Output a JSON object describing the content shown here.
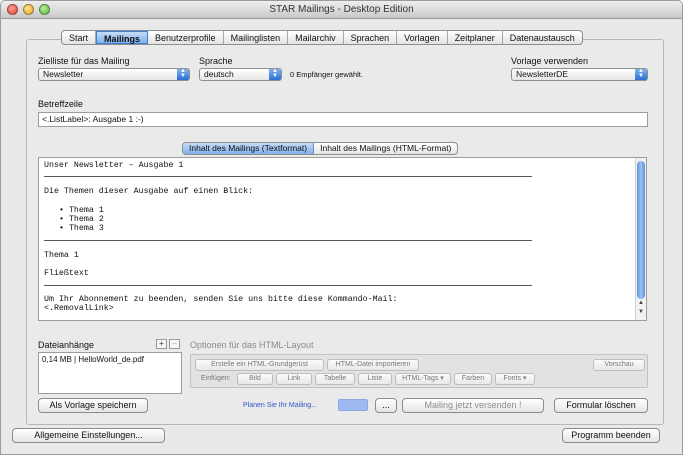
{
  "window": {
    "title": "STAR Mailings - Desktop Edition"
  },
  "tabs": [
    {
      "label": "Start"
    },
    {
      "label": "Mailings",
      "active": true
    },
    {
      "label": "Benutzerprofile"
    },
    {
      "label": "Mailinglisten"
    },
    {
      "label": "Mailarchiv"
    },
    {
      "label": "Sprachen"
    },
    {
      "label": "Vorlagen"
    },
    {
      "label": "Zeitplaner"
    },
    {
      "label": "Datenaustausch"
    }
  ],
  "form": {
    "zielliste_label": "Zielliste für das Mailing",
    "zielliste_value": "Newsletter",
    "sprache_label": "Sprache",
    "sprache_value": "deutsch",
    "empfaenger_text": "0 Empfänger gewählt.",
    "vorlage_label": "Vorlage verwenden",
    "vorlage_value": "NewsletterDE",
    "betreff_label": "Betreffzeile",
    "betreff_value": "<.ListLabel>: Ausgabe 1 :-)"
  },
  "content_tabs": [
    {
      "label": "Inhalt des Mailings (Textformat)",
      "active": true
    },
    {
      "label": "Inhalt des Mailings (HTML-Format)"
    }
  ],
  "mail_body": {
    "line1": "Unser Newsletter – Ausgabe 1",
    "line2": "Die Themen dieser Ausgabe auf einen Blick:",
    "bullets": [
      "• Thema 1",
      "• Thema 2",
      "• Thema 3"
    ],
    "line3": "Thema 1",
    "line4": "Fließtext",
    "line5": "Um Ihr Abonnement zu beenden, senden Sie uns bitte diese Kommando-Mail:",
    "line6": "<.RemovalLink>"
  },
  "attachments": {
    "label": "Dateianhänge",
    "add": "+",
    "remove": "−",
    "items": [
      "0,14 MB | HelloWorld_de.pdf"
    ]
  },
  "html_options": {
    "label": "Optionen für das HTML-Layout",
    "btn_grundgeruest": "Erstelle ein HTML-Grundgerüst",
    "btn_import": "HTML-Datei importieren",
    "btn_preview": "Vorschau",
    "einfuegen_label": "Einfügen:",
    "insert_buttons": [
      "Bild",
      "Link",
      "Tabelle",
      "Liste",
      "HTML-Tags ▾",
      "Farben",
      "Fonts ▾"
    ]
  },
  "actions": {
    "save_template": "Als Vorlage speichern",
    "plan_link": "Planen Sie Ihr Mailing...",
    "more": "...",
    "send": "Mailing jetzt versenden !",
    "clear": "Formular löschen"
  },
  "footer": {
    "settings": "Allgemeine Einstellungen...",
    "quit": "Programm beenden"
  }
}
